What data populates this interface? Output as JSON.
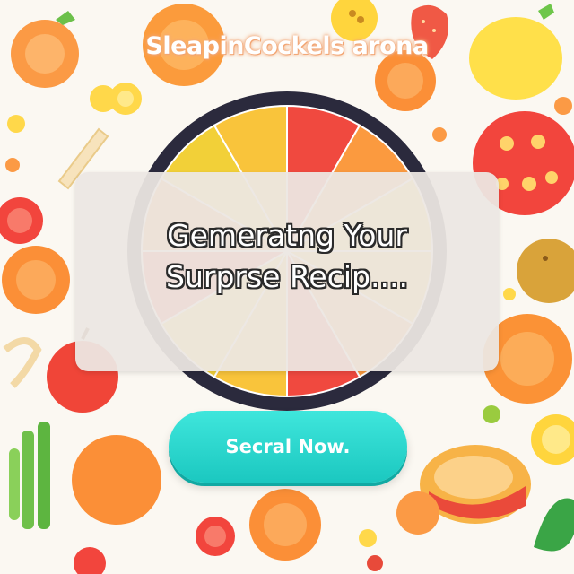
{
  "app": {
    "title": "SleapinCockels arona"
  },
  "loading": {
    "line1": "Gemeratng Your",
    "line2": "Surprse Recip...."
  },
  "action": {
    "button_label": "Secral Now."
  },
  "colors": {
    "background": "#fbf8f2",
    "button": "#22cfc6",
    "wheel_rim": "#2b2a3d",
    "overlay": "#ece7e2"
  },
  "icons": [
    "fruit-illustration",
    "vegetable-illustration",
    "recipe-wheel"
  ]
}
